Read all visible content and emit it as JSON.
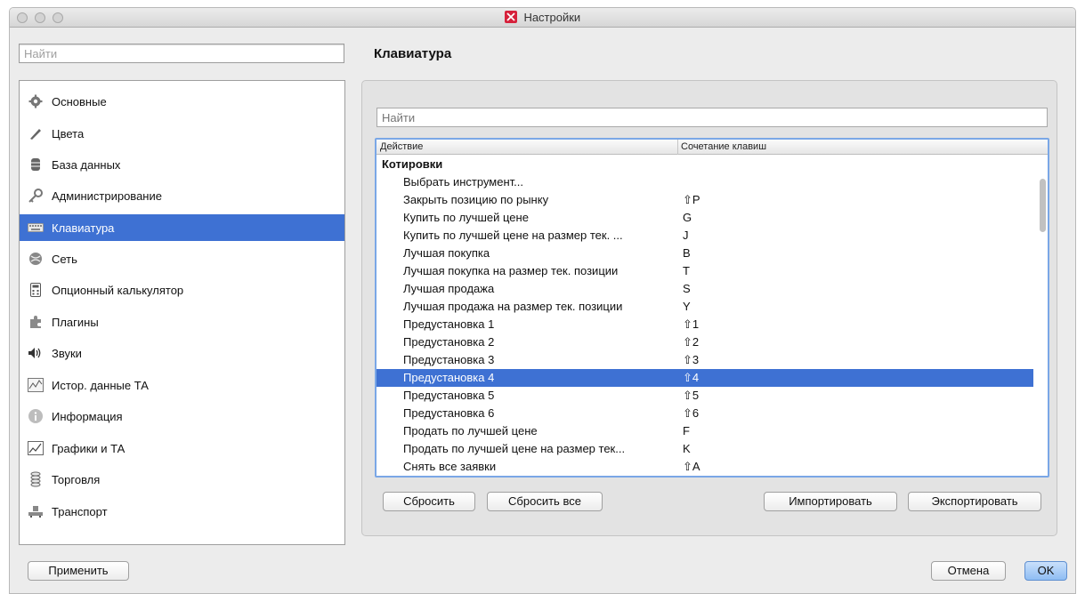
{
  "window": {
    "title": "Настройки"
  },
  "left_search": {
    "placeholder": "Найти"
  },
  "sidebar": {
    "items": [
      {
        "label": "Основные",
        "icon": "gear-icon"
      },
      {
        "label": "Цвета",
        "icon": "brush-icon"
      },
      {
        "label": "База данных",
        "icon": "database-icon"
      },
      {
        "label": "Администрирование",
        "icon": "key-icon"
      },
      {
        "label": "Клавиатура",
        "icon": "keyboard-icon",
        "selected": true
      },
      {
        "label": "Сеть",
        "icon": "network-icon"
      },
      {
        "label": "Опционный калькулятор",
        "icon": "calculator-icon"
      },
      {
        "label": "Плагины",
        "icon": "puzzle-icon"
      },
      {
        "label": "Звуки",
        "icon": "speaker-icon"
      },
      {
        "label": "Истор. данные ТА",
        "icon": "history-chart-icon"
      },
      {
        "label": "Информация",
        "icon": "info-icon"
      },
      {
        "label": "Графики и ТА",
        "icon": "line-chart-icon"
      },
      {
        "label": "Торговля",
        "icon": "coins-icon"
      },
      {
        "label": "Транспорт",
        "icon": "transport-icon"
      }
    ]
  },
  "main": {
    "title": "Клавиатура",
    "search": {
      "placeholder": "Найти"
    },
    "table": {
      "columns": [
        "Действие",
        "Сочетание клавиш"
      ],
      "rows": [
        {
          "action": "Котировки",
          "shortcut": "",
          "group": true
        },
        {
          "action": "Выбрать инструмент...",
          "shortcut": ""
        },
        {
          "action": "Закрыть позицию по рынку",
          "shortcut": "⇧P"
        },
        {
          "action": "Купить по лучшей цене",
          "shortcut": "G"
        },
        {
          "action": "Купить по лучшей цене на размер тек. ...",
          "shortcut": "J"
        },
        {
          "action": "Лучшая покупка",
          "shortcut": "B"
        },
        {
          "action": "Лучшая покупка на размер тек. позиции",
          "shortcut": "T"
        },
        {
          "action": "Лучшая продажа",
          "shortcut": "S"
        },
        {
          "action": "Лучшая продажа на размер тек. позиции",
          "shortcut": "Y"
        },
        {
          "action": "Предустановка 1",
          "shortcut": "⇧1"
        },
        {
          "action": "Предустановка 2",
          "shortcut": "⇧2"
        },
        {
          "action": "Предустановка 3",
          "shortcut": "⇧3"
        },
        {
          "action": "Предустановка 4",
          "shortcut": "⇧4",
          "selected": true
        },
        {
          "action": "Предустановка 5",
          "shortcut": "⇧5"
        },
        {
          "action": "Предустановка 6",
          "shortcut": "⇧6"
        },
        {
          "action": "Продать по лучшей цене",
          "shortcut": "F"
        },
        {
          "action": "Продать по лучшей цене на размер тек...",
          "shortcut": "K"
        },
        {
          "action": "Снять все заявки",
          "shortcut": "⇧A"
        }
      ]
    },
    "buttons": {
      "reset": "Сбросить",
      "reset_all": "Сбросить все",
      "import": "Импортировать",
      "export": "Экспортировать"
    }
  },
  "footer": {
    "apply": "Применить",
    "cancel": "Отмена",
    "ok": "OK"
  },
  "colors": {
    "selection": "#3e71d3",
    "logo": "#d6213b"
  }
}
